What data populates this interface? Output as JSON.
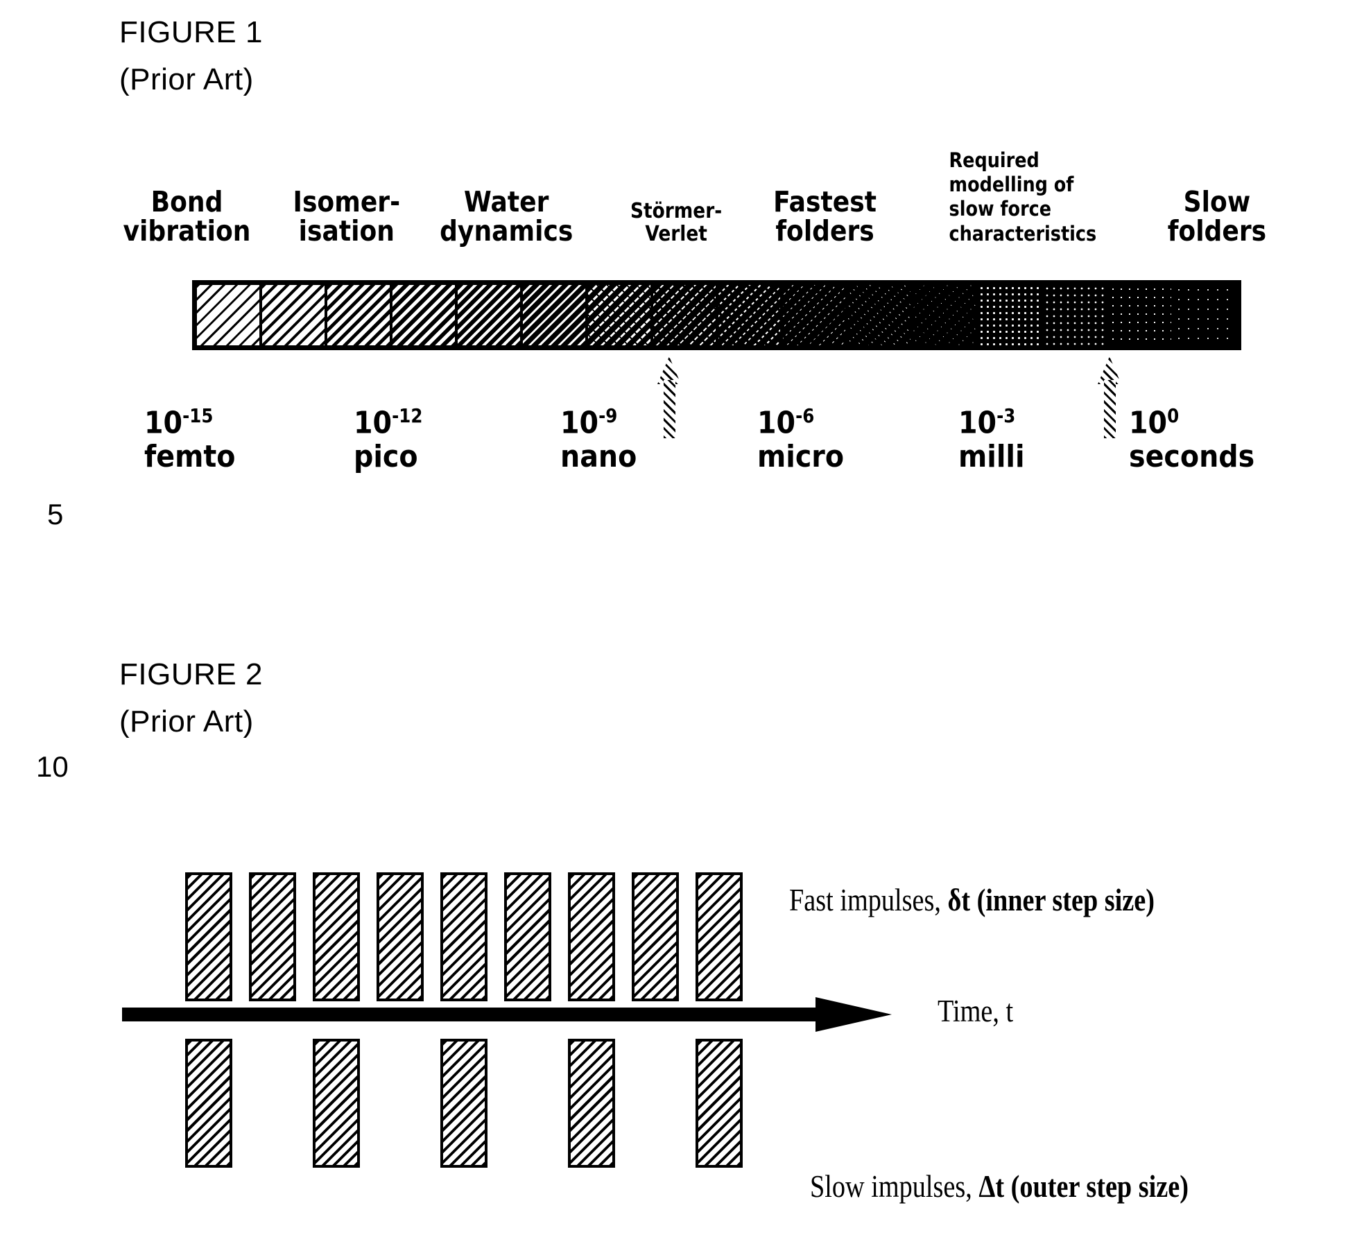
{
  "figure1": {
    "title": "FIGURE 1",
    "subtitle": "(Prior Art)",
    "timeline_labels": [
      {
        "text": "Bond\nvibration",
        "size": "normal"
      },
      {
        "text": "Isomer-\nisation",
        "size": "normal"
      },
      {
        "text": "Water\ndynamics",
        "size": "normal"
      },
      {
        "text": "Störmer-\nVerlet",
        "size": "small"
      },
      {
        "text": "Fastest\nfolders",
        "size": "normal"
      },
      {
        "text": "Required\nmodelling of\nslow force\ncharacteristics",
        "size": "tiny"
      },
      {
        "text": "Slow\nfolders",
        "size": "normal"
      }
    ],
    "scale_ticks": [
      {
        "mantissa": "10",
        "exponent": "-15",
        "unit": "femto"
      },
      {
        "mantissa": "10",
        "exponent": "-12",
        "unit": "pico"
      },
      {
        "mantissa": "10",
        "exponent": "-9",
        "unit": "nano"
      },
      {
        "mantissa": "10",
        "exponent": "-6",
        "unit": "micro"
      },
      {
        "mantissa": "10",
        "exponent": "-3",
        "unit": "milli"
      },
      {
        "mantissa": "10",
        "exponent": "0",
        "unit": "seconds"
      }
    ],
    "arrow_count": 2,
    "bar_segment_count": 16,
    "bar_color": "#000000"
  },
  "figure2": {
    "title": "FIGURE 2",
    "subtitle": "(Prior Art)",
    "fast_impulses_label": {
      "plain": "Fast impulses, ",
      "bold": "δt (inner step size)"
    },
    "time_axis_label": "Time, t",
    "slow_impulses_label": {
      "plain": "Slow impulses, ",
      "bold": "Δt (outer step size)"
    },
    "fast_impulse_count": 9,
    "slow_impulse_count": 5
  },
  "line_numbers": {
    "first": "5",
    "second": "10"
  }
}
